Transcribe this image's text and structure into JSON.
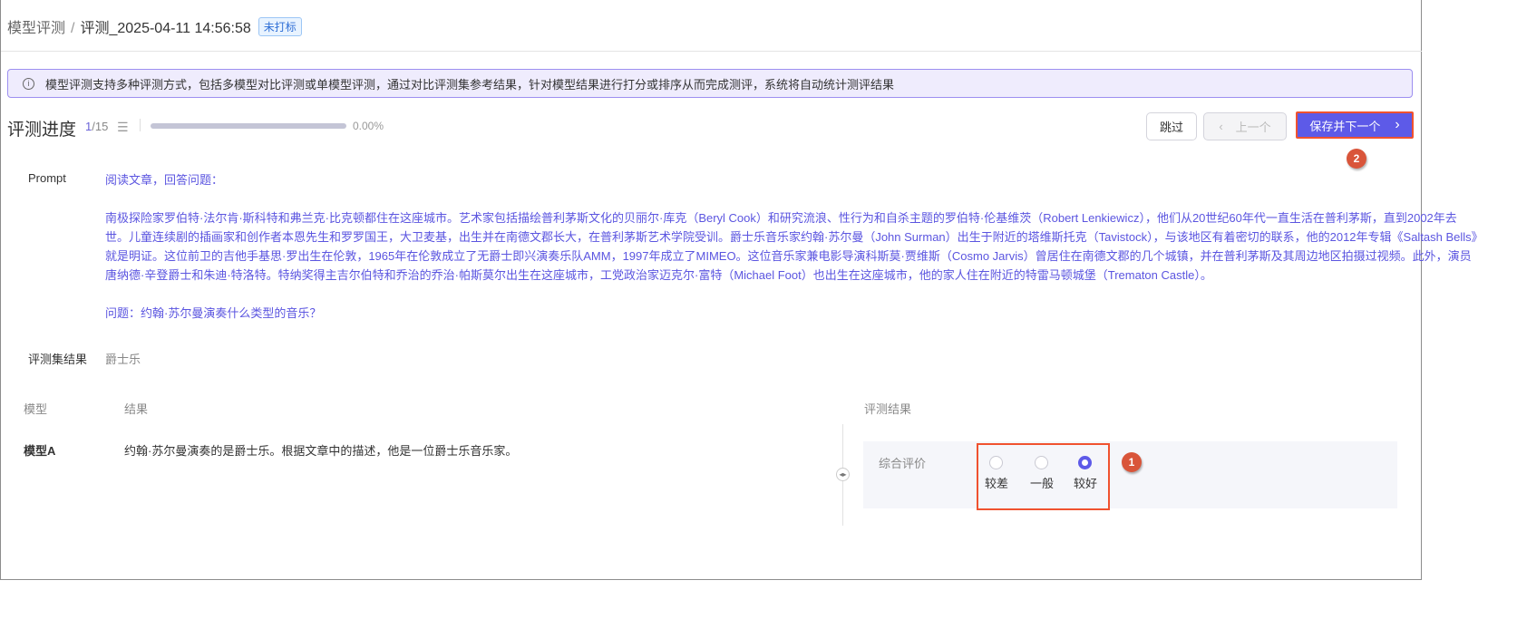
{
  "header": {
    "breadcrumb_root": "模型评测",
    "breadcrumb_sep": "/",
    "breadcrumb_current": "评测_2025-04-11 14:56:58",
    "status_tag": "未打标"
  },
  "alert": {
    "icon": "info-icon",
    "text": "模型评测支持多种评测方式，包括多模型对比评测或单模型评测，通过对比评测集参考结果，针对模型结果进行打分或排序从而完成测评，系统将自动统计测评结果"
  },
  "progress": {
    "title": "评测进度",
    "current": "1",
    "total": "/15",
    "percent_label": "0.00%",
    "percent": 0
  },
  "buttons": {
    "skip": "跳过",
    "prev": "上一个",
    "next": "保存并下一个"
  },
  "annotations": {
    "badge1": "1",
    "badge2": "2"
  },
  "prompt": {
    "label": "Prompt",
    "intro": "阅读文章，回答问题：",
    "passage": "南极探险家罗伯特·法尔肯·斯科特和弗兰克·比克顿都住在这座城市。艺术家包括描绘普利茅斯文化的贝丽尔·库克（Beryl Cook）和研究流浪、性行为和自杀主题的罗伯特·伦基维茨（Robert Lenkiewicz），他们从20世纪60年代一直生活在普利茅斯，直到2002年去世。儿童连续剧的插画家和创作者本恩先生和罗罗国王，大卫麦基，出生并在南德文郡长大，在普利茅斯艺术学院受训。爵士乐音乐家约翰·苏尔曼（John Surman）出生于附近的塔维斯托克（Tavistock），与该地区有着密切的联系，他的2012年专辑《Saltash Bells》就是明证。这位前卫的吉他手基思·罗出生在伦敦，1965年在伦敦成立了无爵士即兴演奏乐队AMM，1997年成立了MIMEO。这位音乐家兼电影导演科斯莫·贾维斯（Cosmo Jarvis）曾居住在南德文郡的几个城镇，并在普利茅斯及其周边地区拍摄过视频。此外，演员唐纳德·辛登爵士和朱迪·特洛特。特纳奖得主吉尔伯特和乔治的乔治·帕斯莫尔出生在这座城市，工党政治家迈克尔·富特（Michael Foot）也出生在这座城市，他的家人住在附近的特雷马顿城堡（Trematon Castle）。",
    "question": "问题：约翰·苏尔曼演奏什么类型的音乐？"
  },
  "reference": {
    "label": "评测集结果",
    "value": "爵士乐"
  },
  "table": {
    "col_model": "模型",
    "col_result": "结果",
    "col_eval": "评测结果",
    "rows": [
      {
        "model": "模型A",
        "result": "约翰·苏尔曼演奏的是爵士乐。根据文章中的描述，他是一位爵士乐音乐家。"
      }
    ]
  },
  "evaluation": {
    "label": "综合评价",
    "options": [
      "较差",
      "一般",
      "较好"
    ],
    "selected": "较好"
  }
}
